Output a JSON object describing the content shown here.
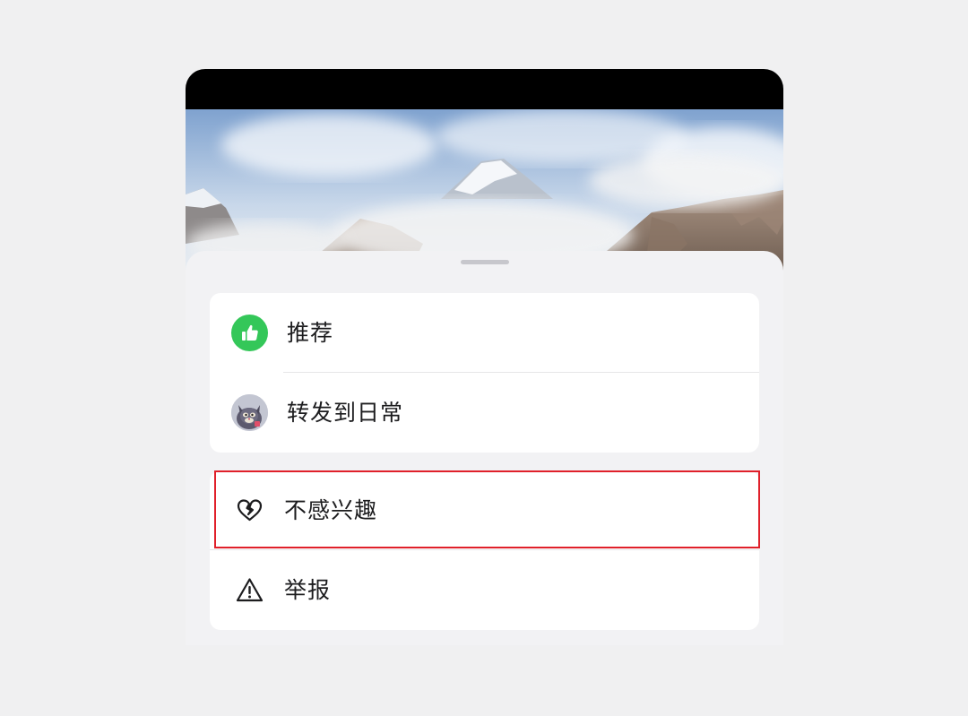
{
  "menu": {
    "primary_items": [
      {
        "label": "推荐",
        "icon": "thumbs-up-icon"
      },
      {
        "label": "转发到日常",
        "icon": "avatar"
      }
    ],
    "secondary_items": [
      {
        "label": "不感兴趣",
        "icon": "broken-heart-icon"
      },
      {
        "label": "举报",
        "icon": "warning-icon"
      }
    ]
  },
  "colors": {
    "recommend_icon_bg": "#34c759",
    "highlight_border": "#e0202a",
    "sheet_bg": "#f2f2f4",
    "group_bg": "#ffffff"
  },
  "highlighted_item": "不感兴趣"
}
